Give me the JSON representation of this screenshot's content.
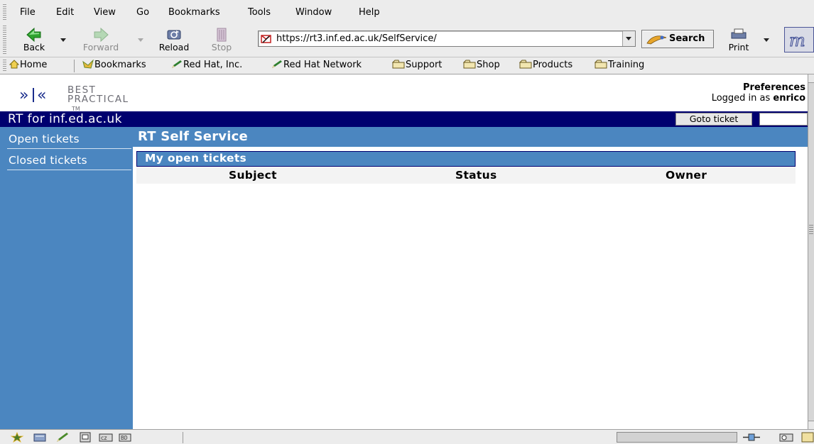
{
  "browser": {
    "menus": [
      "File",
      "Edit",
      "View",
      "Go",
      "Bookmarks",
      "Tools",
      "Window",
      "Help"
    ],
    "toolbar": {
      "back_label": "Back",
      "forward_label": "Forward",
      "reload_label": "Reload",
      "stop_label": "Stop",
      "print_label": "Print",
      "search_label": "Search"
    },
    "url": "https://rt3.inf.ed.ac.uk/SelfService/",
    "personal_toolbar": [
      {
        "label": "Home",
        "icon": "home-icon"
      },
      {
        "label": "Bookmarks",
        "icon": "bookmarks-icon"
      },
      {
        "label": "Red Hat, Inc.",
        "icon": "pencil-icon"
      },
      {
        "label": "Red Hat Network",
        "icon": "pencil-icon"
      },
      {
        "label": "Support",
        "icon": "folder-icon"
      },
      {
        "label": "Shop",
        "icon": "folder-icon"
      },
      {
        "label": "Products",
        "icon": "folder-icon"
      },
      {
        "label": "Training",
        "icon": "folder-icon"
      }
    ]
  },
  "page": {
    "logo": {
      "line1": "BEST",
      "line2": "PRACTICAL",
      "tm": "TM"
    },
    "preferences_label": "Preferences",
    "logged_in_prefix": "Logged in as ",
    "logged_in_user": "enrico",
    "site_title": "RT for inf.ed.ac.uk",
    "goto_ticket_label": "Goto ticket",
    "goto_ticket_value": "",
    "nav": {
      "open_tickets": "Open tickets",
      "closed_tickets": "Closed tickets"
    },
    "header_title": "RT Self Service",
    "box_title": "My open tickets",
    "table": {
      "columns": [
        "Subject",
        "Status",
        "Owner"
      ],
      "rows": []
    }
  },
  "colors": {
    "navy": "#00006f",
    "blue": "#4b86c0",
    "chrome": "#ececec"
  }
}
